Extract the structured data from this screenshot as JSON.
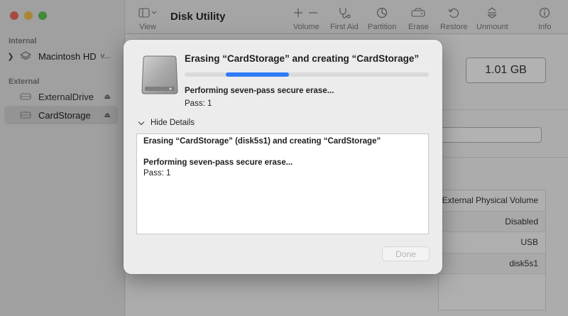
{
  "window": {
    "app_title": "Disk Utility"
  },
  "sidebar": {
    "sections": [
      {
        "title": "Internal",
        "items": [
          {
            "label": "Macintosh HD",
            "suffix": "v...",
            "icon": "layers-icon",
            "expanded": false
          }
        ]
      },
      {
        "title": "External",
        "items": [
          {
            "label": "ExternalDrive",
            "icon": "drive-icon",
            "eject": true,
            "selected": false
          },
          {
            "label": "CardStorage",
            "icon": "drive-icon",
            "eject": true,
            "selected": true
          }
        ]
      }
    ]
  },
  "toolbar": {
    "view_label": "View",
    "volume_label": "Volume",
    "first_aid_label": "First Aid",
    "partition_label": "Partition",
    "erase_label": "Erase",
    "restore_label": "Restore",
    "unmount_label": "Unmount",
    "info_label": "Info"
  },
  "main": {
    "capacity": "1.01 GB",
    "info_rows": [
      "USB External Physical Volume",
      "Disabled",
      "USB",
      "disk5s1"
    ]
  },
  "sheet": {
    "title": "Erasing “CardStorage” and creating “CardStorage”",
    "progress": 0.26,
    "progress_color": "#2f7bf6",
    "status": "Performing seven-pass secure erase...",
    "pass": "Pass: 1",
    "details_toggle": "Hide Details",
    "log": {
      "line1": "Erasing “CardStorage” (disk5s1) and creating “CardStorage”",
      "line2": "Performing seven-pass secure erase...",
      "line3": "Pass: 1"
    },
    "done_label": "Done"
  }
}
